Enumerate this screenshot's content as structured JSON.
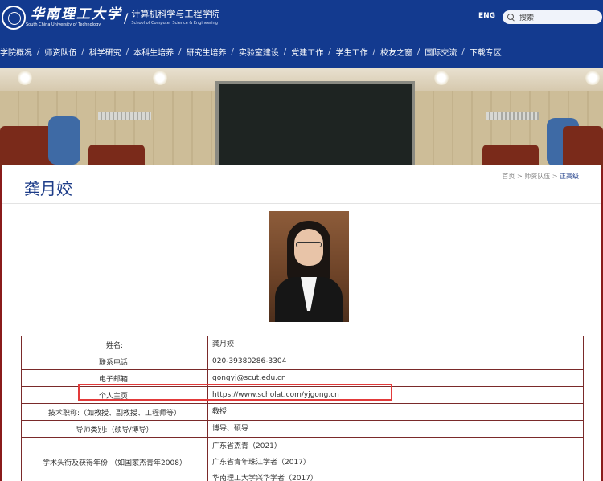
{
  "header": {
    "university_cn": "华南理工大学",
    "university_en": "South China University of Technology",
    "school_cn": "计算机科学与工程学院",
    "school_en": "School of Computer Science & Engineering",
    "lang_label": "ENG",
    "search_placeholder": "搜索"
  },
  "nav": [
    "学院概况",
    "师资队伍",
    "科学研究",
    "本科生培养",
    "研究生培养",
    "实验室建设",
    "党建工作",
    "学生工作",
    "校友之窗",
    "国际交流",
    "下载专区"
  ],
  "page": {
    "title": "龚月姣",
    "breadcrumb": [
      "首页",
      "师资队伍",
      "正高级"
    ]
  },
  "profile": [
    {
      "key": "姓名:",
      "value": [
        "龚月姣"
      ]
    },
    {
      "key": "联系电话:",
      "value": [
        "020-39380286-3304"
      ]
    },
    {
      "key": "电子邮箱:",
      "value": [
        "gongyj@scut.edu.cn"
      ]
    },
    {
      "key": "个人主页:",
      "value": [
        "https://www.scholat.com/yjgong.cn"
      ]
    },
    {
      "key": "技术职称:（如教授、副教授、工程师等）",
      "value": [
        "教授"
      ]
    },
    {
      "key": "导师类别:（硕导/博导）",
      "value": [
        "博导、硕导"
      ]
    },
    {
      "key": "学术头衔及获得年份:（如国家杰青年2008）",
      "value": [
        "广东省杰青（2021）",
        "广东省青年珠江学者（2017）",
        "华南理工大学兴华学者（2017）"
      ]
    }
  ],
  "colors": {
    "header_bg": "#133a8f",
    "title_blue": "#1d3c88",
    "table_border": "#7a2a2a",
    "highlight_red": "#e33a3a",
    "page_border": "#8a1b1b"
  }
}
